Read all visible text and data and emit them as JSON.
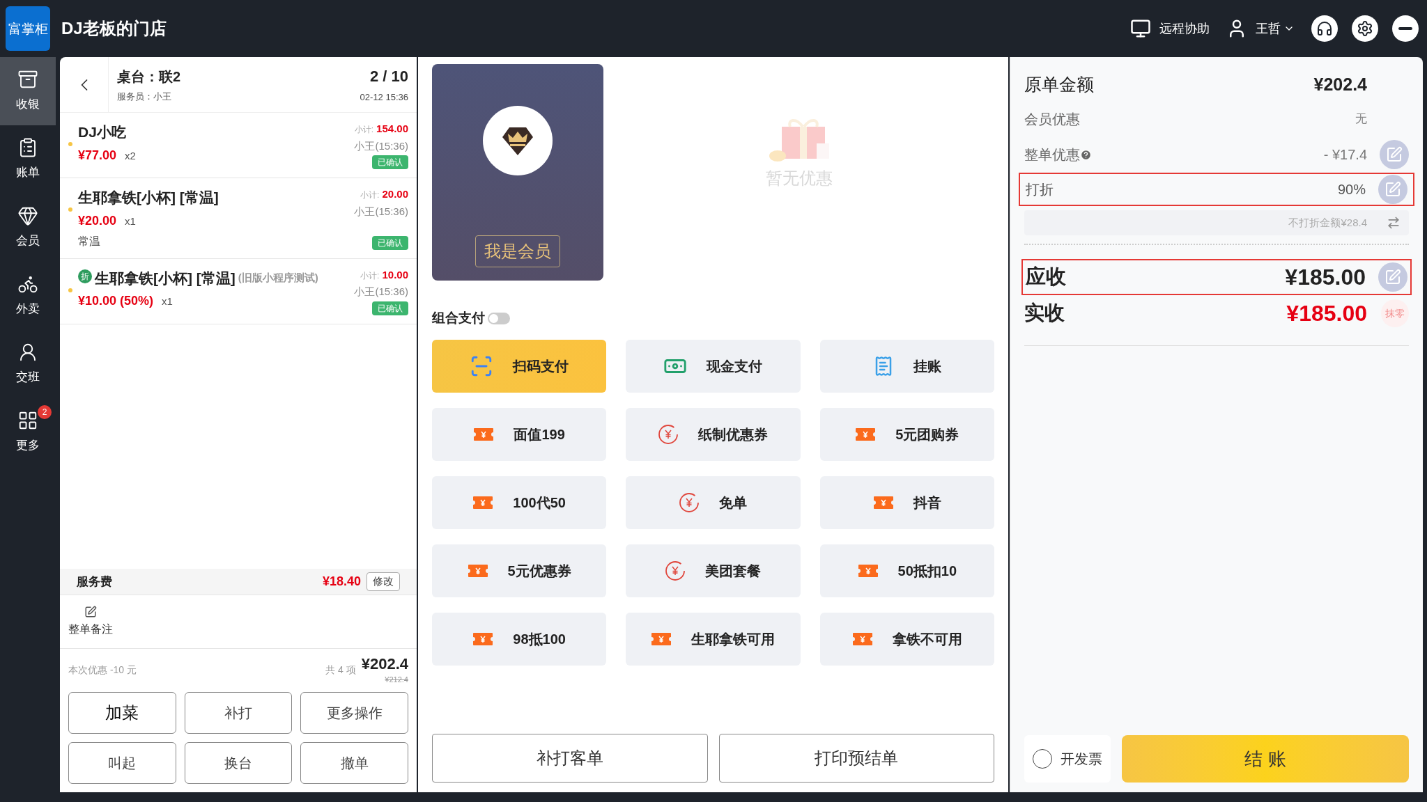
{
  "header": {
    "logo_text": "富掌柜",
    "store_name": "DJ老板的门店",
    "remote_help": "远程协助",
    "user": "王哲"
  },
  "sidebar": {
    "items": [
      {
        "label": "收银",
        "selected": true
      },
      {
        "label": "账单",
        "selected": false
      },
      {
        "label": "会员",
        "selected": false
      },
      {
        "label": "外卖",
        "selected": false
      },
      {
        "label": "交班",
        "selected": false
      },
      {
        "label": "更多",
        "selected": false,
        "badge": "2"
      }
    ]
  },
  "order": {
    "table": "桌台：联2",
    "server": "服务员：小王",
    "page": "2 / 10",
    "time": "02-12 15:36",
    "items": [
      {
        "name": "DJ小吃",
        "price": "¥77.00",
        "qty": "x2",
        "subtotal_label": "小计:",
        "subtotal": "154.00",
        "staff_time": "小王(15:36)",
        "status": "已确认"
      },
      {
        "name": "生耶拿铁[小杯] [常温]",
        "price": "¥20.00",
        "qty": "x1",
        "note": "常温",
        "subtotal_label": "小计:",
        "subtotal": "20.00",
        "staff_time": "小王(15:36)",
        "status": "已确认"
      },
      {
        "badge": "折",
        "name": "生耶拿铁[小杯] [常温]",
        "suffix": "(旧版小程序测试)",
        "price": "¥10.00 (50%)",
        "qty": "x1",
        "subtotal_label": "小计:",
        "subtotal": "10.00",
        "staff_time": "小王(15:36)",
        "status": "已确认"
      }
    ],
    "service_fee": {
      "label": "服务费",
      "amount": "¥18.40",
      "button": "修改"
    },
    "note_button": "整单备注",
    "discount_text": "本次优惠 -10 元",
    "count": "共 4 项",
    "total": "¥202.4",
    "original_total": "¥212.4",
    "actions": [
      "加菜",
      "补打",
      "更多操作",
      "叫起",
      "换台",
      "撤单"
    ]
  },
  "member_card": {
    "button": "我是会员"
  },
  "promotions": {
    "empty_text": "暂无优惠"
  },
  "combo_pay": {
    "label": "组合支付",
    "on": false
  },
  "pay_methods": [
    {
      "label": "扫码支付",
      "kind": "scan",
      "selected": true
    },
    {
      "label": "现金支付",
      "kind": "cash",
      "selected": false
    },
    {
      "label": "挂账",
      "kind": "credit",
      "selected": false
    },
    {
      "label": "面值199",
      "kind": "voucher",
      "selected": false
    },
    {
      "label": "纸制优惠券",
      "kind": "coupon",
      "selected": false
    },
    {
      "label": "5元团购券",
      "kind": "voucher",
      "selected": false
    },
    {
      "label": "100代50",
      "kind": "voucher",
      "selected": false
    },
    {
      "label": "免单",
      "kind": "coupon",
      "selected": false
    },
    {
      "label": "抖音",
      "kind": "voucher",
      "selected": false
    },
    {
      "label": "5元优惠券",
      "kind": "voucher",
      "selected": false
    },
    {
      "label": "美团套餐",
      "kind": "coupon",
      "selected": false
    },
    {
      "label": "50抵扣10",
      "kind": "voucher",
      "selected": false
    },
    {
      "label": "98抵100",
      "kind": "voucher",
      "selected": false
    },
    {
      "label": "生耶拿铁可用",
      "kind": "voucher",
      "selected": false
    },
    {
      "label": "拿铁不可用",
      "kind": "voucher",
      "selected": false
    }
  ],
  "print_buttons": [
    "补打客单",
    "打印预结单"
  ],
  "summary": {
    "original": {
      "label": "原单金额",
      "value": "¥202.4"
    },
    "member_discount": {
      "label": "会员优惠",
      "value": "无"
    },
    "order_discount": {
      "label": "整单优惠",
      "value": "- ¥17.4"
    },
    "rate": {
      "label": "打折",
      "value": "90%",
      "highlighted": true
    },
    "non_discount": "不打折金额¥28.4",
    "receivable": {
      "label": "应收",
      "value": "¥185.00",
      "highlighted": true
    },
    "received": {
      "label": "实收",
      "value": "¥185.00",
      "round_off": "抹零"
    }
  },
  "invoice": {
    "label": "开发票",
    "checked": false
  },
  "checkout_button": "结 账"
}
